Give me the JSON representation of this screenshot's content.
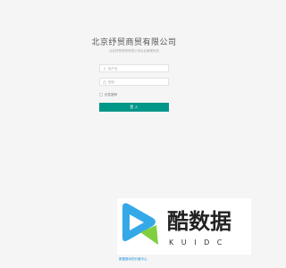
{
  "title": "北京纾贸商贸有限公司",
  "subtitle": "北京纾贸商贸有限公司后台管理系统",
  "username": {
    "placeholder": "用户名",
    "value": ""
  },
  "password": {
    "placeholder": "密码",
    "value": ""
  },
  "remember_label": "记住密码",
  "login_label": "登 入",
  "logo": {
    "text": "酷数据",
    "letters": "K U I D C",
    "colors": {
      "primary": "#35a8e8",
      "secondary": "#7fcf3f",
      "text": "#222222"
    }
  },
  "footer_link": "数据驱动的价值中心",
  "colors": {
    "button": "#009688",
    "background": "#f5f5f5",
    "link": "#1a8fd6"
  }
}
